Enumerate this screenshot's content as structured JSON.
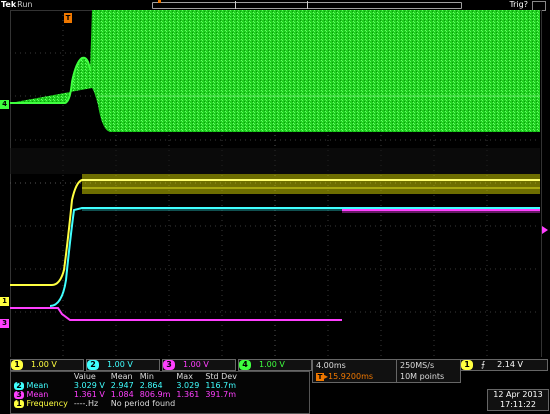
{
  "topbar": {
    "brand": "Tek",
    "state": "Run",
    "trigger_state": "Trig?"
  },
  "trigger_marker": "T",
  "channel_markers": {
    "ch4": "4",
    "ch1": "1",
    "ch3": "3"
  },
  "channels": [
    {
      "num": "1",
      "scale": "1.00 V",
      "color": "#ffff40"
    },
    {
      "num": "2",
      "scale": "1.00 V",
      "color": "#40ffff"
    },
    {
      "num": "3",
      "scale": "1.00 V",
      "color": "#ff40ff"
    },
    {
      "num": "4",
      "scale": "1.00 V",
      "color": "#3fff3f"
    }
  ],
  "horizontal": {
    "timebase": "4.00ms",
    "trigger_offset": "▸15.9200ms"
  },
  "sample": {
    "rate": "250MS/s",
    "record": "10M points"
  },
  "trigger": {
    "channel": "1",
    "edge": "⨍",
    "level": "2.14 V"
  },
  "datetime": {
    "date": "12 Apr 2013",
    "time": "17:11:22"
  },
  "measurements": {
    "headers": [
      "Value",
      "Mean",
      "Min",
      "Max",
      "Std Dev"
    ],
    "rows": [
      {
        "ch": "2",
        "name": "Mean",
        "value": "3.029 V",
        "mean": "2.947",
        "min": "2.864",
        "max": "3.029",
        "std": "116.7m"
      },
      {
        "ch": "3",
        "name": "Mean",
        "value": "1.361 V",
        "mean": "1.084",
        "min": "806.9m",
        "max": "1.361",
        "std": "391.7m"
      }
    ],
    "freq": {
      "ch": "1",
      "name": "Frequency",
      "value": "----.Hz",
      "note": "No period found"
    }
  }
}
